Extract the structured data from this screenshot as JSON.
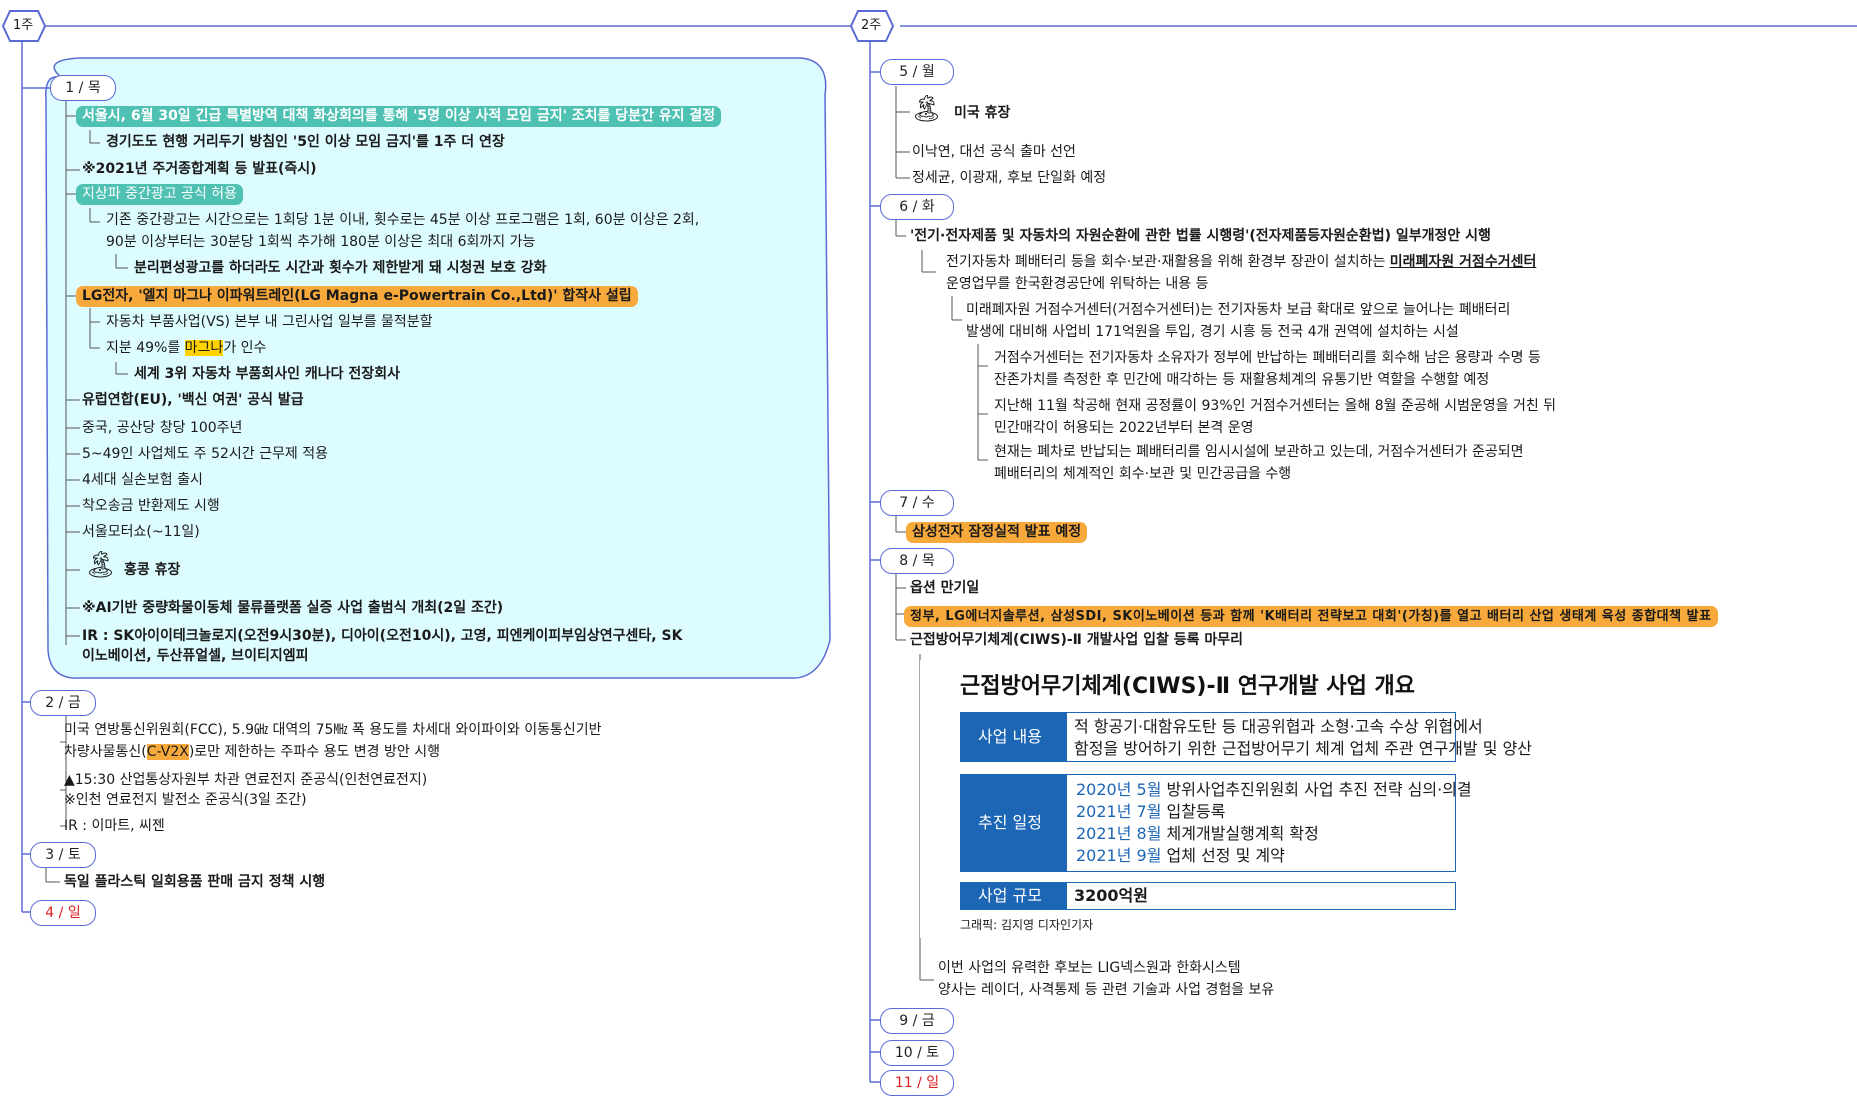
{
  "weeks": [
    {
      "label": "1주"
    },
    {
      "label": "2주"
    }
  ],
  "days": {
    "thu1": "1 / 목",
    "fri2": "2 / 금",
    "sat3": "3 / 토",
    "sun4": "4 / 일",
    "mon5": "5 / 월",
    "tue6": "6 / 화",
    "wed7": "7 / 수",
    "thu8": "8 / 목",
    "fri9": "9 / 금",
    "sat10": "10 / 토",
    "sun11": "11 / 일"
  },
  "thu1": {
    "i1": "서울시, 6월 30일 긴급 특별방역 대책 화상회의를 통해 '5명 이상 사적 모임 금지' 조치를 당분간 유지 결정",
    "i1a": "경기도도 현행 거리두기 방침인 '5인 이상 모임 금지'를 1주 더 연장",
    "i2": "※2021년 주거종합계획 등 발표(즉시)",
    "i3": "지상파 중간광고 공식 허용",
    "i3a_1": "기존 중간광고는 시간으로는 1회당 1분 이내, 횟수로는 45분 이상 프로그램은 1회, 60분 이상은 2회,",
    "i3a_2": "90분 이상부터는 30분당 1회씩 추가해 180분 이상은 최대 6회까지 가능",
    "i3b": "분리편성광고를 하더라도 시간과 횟수가 제한받게 돼 시청권 보호 강화",
    "i4": "LG전자, '엘지 마그나 이파워트레인(LG Magna e-Powertrain Co.,Ltd)' 합작사 설립",
    "i4a": "자동차 부품사업(VS) 본부 내 그린사업 일부를 물적분할",
    "i4b_pre": "지분 49%를 ",
    "i4b_mark": "마그나",
    "i4b_post": "가 인수",
    "i4c": "세계 3위 자동차 부품회사인 캐나다 전장회사",
    "i5": "유럽연합(EU), '백신 여권' 공식 발급",
    "i6": "중국, 공산당 창당 100주년",
    "i7": "5~49인 사업체도 주 52시간 근무제 적용",
    "i8": "4세대 실손보험 출시",
    "i9": "착오송금 반환제도 시행",
    "i10": "서울모터쇼(~11일)",
    "i11": "홍콩 휴장",
    "i12": "※AI기반 중량화물이동체 물류플랫폼 실증 사업 출범식 개최(2일 조간)",
    "i13_1": "IR : SK아이이테크놀로지(오전9시30분), 디아이(오전10시), 고영, 피엔케이피부임상연구센타, SK",
    "i13_2": "이노베이션, 두산퓨얼셀, 브이티지엠피"
  },
  "fri2": {
    "i1_1": "미국 연방통신위원회(FCC), 5.9㎓ 대역의 75㎒ 폭 용도를 차세대 와이파이와 이동통신기반",
    "i1_2_pre": "차량사물통신(",
    "i1_2_mark": "C-V2X",
    "i1_2_post": ")로만 제한하는 주파수 용도 변경 방안  시행",
    "i2_1": "▲15:30 산업통상자원부 차관 연료전지 준공식(인천연료전지)",
    "i2_2": "※인천 연료전지 발전소 준공식(3일 조간)",
    "i3": "IR : 이마트, 씨젠"
  },
  "sat3": {
    "i1": "독일 플라스틱 일회용품 판매 금지 정책 시행"
  },
  "mon5": {
    "i1": "미국 휴장",
    "i2": "이낙연, 대선 공식 출마 선언",
    "i3": "정세균, 이광재, 후보 단일화 예정"
  },
  "tue6": {
    "i1": "'전기·전자제품 및 자동차의 자원순환에 관한 법률 시행령'(전자제품등자원순환법) 일부개정안 시행",
    "i1a_1_pre": "전기자동차 폐배터리 등을 회수·보관·재활용을 위해 환경부 장관이 설치하는 ",
    "i1a_1_u": "미래폐자원 거점수거센터",
    "i1a_2": "운영업무를 한국환경공단에 위탁하는 내용 등",
    "i1b_1": "미래폐자원 거점수거센터(거점수거센터)는 전기자동차 보급 확대로 앞으로 늘어나는 폐배터리",
    "i1b_2": "발생에 대비해 사업비 171억원을 투입, 경기 시흥 등 전국 4개 권역에 설치하는 시설",
    "i1c_1": "거점수거센터는 전기자동차 소유자가 정부에 반납하는 폐배터리를 회수해 남은 용량과 수명 등",
    "i1c_2": "잔존가치를 측정한 후 민간에 매각하는 등 재활용체계의 유통기반 역할을 수행할 예정",
    "i1d_1": "지난해 11월 착공해 현재 공정률이 93%인 거점수거센터는 올해 8월 준공해 시범운영을 거친 뒤",
    "i1d_2": "민간매각이 허용되는 2022년부터 본격 운영",
    "i1e_1": "현재는 폐차로 반납되는 폐배터리를 임시시설에 보관하고 있는데, 거점수거센터가 준공되면",
    "i1e_2": "폐배터리의 체계적인 회수·보관 및 민간공급을 수행"
  },
  "wed7": {
    "i1": "삼성전자 잠정실적 발표 예정"
  },
  "thu8": {
    "i1": "옵션 만기일",
    "i2": "정부, LG에너지솔루션, 삼성SDI, SK이노베이션 등과 함께 'K배터리 전략보고 대회'(가칭)를 열고 배터리 산업 생태계 육성 종합대책 발표",
    "i3": "근접방어무기체계(CIWS)-Ⅱ 개발사업 입찰 등록 마무리",
    "i4_1": "이번 사업의 유력한 후보는 LIG넥스원과 한화시스템",
    "i4_2": "양사는 레이더, 사격통제 등 관련 기술과 사업 경험을 보유"
  },
  "infographic": {
    "title": "근접방어무기체계(CIWS)-Ⅱ 연구개발 사업 개요",
    "content_label": "사업 내용",
    "content_1": "적 항공기·대함유도탄 등 대공위협과 소형·고속 수상 위협에서",
    "content_2": "함정을 방어하기 위한 근접방어무기 체계 업체 주관 연구개발 및 양산",
    "schedule_label": "추진 일정",
    "schedule": [
      {
        "date": "2020년 5월",
        "desc": "방위사업추진위원회 사업 추진 전략 심의·의결"
      },
      {
        "date": "2021년 7월",
        "desc": "입찰등록"
      },
      {
        "date": "2021년 8월",
        "desc": "체계개발실행계획 확정"
      },
      {
        "date": "2021년 9월",
        "desc": "업체 선정 및 계약"
      }
    ],
    "scale_label": "사업 규모",
    "scale_value": "3200억원",
    "credit": "그래픽: 김지영 디자인기자"
  },
  "icons": {
    "holiday": "palm-tree-icon",
    "week": "hexagon-week-icon"
  },
  "colors": {
    "teal_highlight": "#4fc1b3",
    "orange_highlight": "#f8a93b",
    "yellow_mark": "#ffd200",
    "node_border": "#5b6bd6",
    "bubble_fill": "#ddfcff",
    "sunday": "#e02020",
    "info_blue": "#1c66b5"
  }
}
